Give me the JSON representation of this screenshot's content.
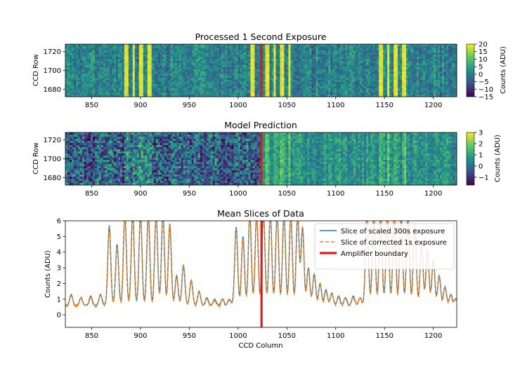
{
  "chart_data": [
    {
      "type": "heatmap",
      "title": "Processed 1 Second Exposure",
      "xlabel": "",
      "ylabel": "CCD Row",
      "xlim": [
        823,
        1224
      ],
      "ylim": [
        1672,
        1728
      ],
      "xticks": [
        850,
        900,
        950,
        1000,
        1050,
        1100,
        1150,
        1200
      ],
      "yticks": [
        1680,
        1700,
        1720
      ],
      "colorbar": {
        "label": "Counts (ADU)",
        "range": [
          -15,
          20
        ],
        "ticks": [
          -15,
          -10,
          -5,
          0,
          5,
          10,
          15,
          20
        ]
      },
      "colormap": "viridis",
      "bright_columns": [
        885,
        893,
        901,
        909,
        1015,
        1030,
        1038,
        1045,
        1053,
        1146,
        1154,
        1162,
        1170
      ],
      "amplifier_boundary": 1024
    },
    {
      "type": "heatmap",
      "title": "Model Prediction",
      "xlabel": "",
      "ylabel": "CCD Row",
      "xlim": [
        823,
        1224
      ],
      "ylim": [
        1672,
        1728
      ],
      "xticks": [
        850,
        900,
        950,
        1000,
        1050,
        1100,
        1150,
        1200
      ],
      "yticks": [
        1680,
        1700,
        1720
      ],
      "colorbar": {
        "label": "Counts (ADU)",
        "range": [
          -1.7,
          3
        ],
        "ticks": [
          -1,
          0,
          1,
          2,
          3
        ]
      },
      "colormap": "viridis",
      "amplifier_boundary": 1024
    },
    {
      "type": "line",
      "title": "Mean Slices of Data",
      "xlabel": "CCD Column",
      "ylabel": "Counts (ADU)",
      "xlim": [
        823,
        1224
      ],
      "ylim": [
        -0.8,
        6
      ],
      "xticks": [
        850,
        900,
        950,
        1000,
        1050,
        1100,
        1150,
        1200
      ],
      "yticks": [
        0,
        1,
        2,
        3,
        4,
        5,
        6
      ],
      "legend_position": "top-right",
      "legend": [
        "Slice of scaled 300s exposure",
        "Slice of corrected 1s exposure",
        "Amplifier boundary"
      ],
      "amplifier_boundary": 1024,
      "baseline": 0.6,
      "series": [
        {
          "name": "Slice of scaled 300s exposure",
          "color": "#1f77b4",
          "style": "solid"
        },
        {
          "name": "Slice of corrected 1s exposure",
          "color": "#ff7f0e",
          "style": "dashed"
        }
      ],
      "peaks": [
        {
          "x": 829,
          "y": 1.3
        },
        {
          "x": 839,
          "y": 1.1
        },
        {
          "x": 849,
          "y": 1.2
        },
        {
          "x": 859,
          "y": 1.3
        },
        {
          "x": 868,
          "y": 5.7
        },
        {
          "x": 876,
          "y": 4.5
        },
        {
          "x": 884,
          "y": 6.5
        },
        {
          "x": 892,
          "y": 6.5
        },
        {
          "x": 900,
          "y": 6.5
        },
        {
          "x": 908,
          "y": 6.5
        },
        {
          "x": 916,
          "y": 6.5
        },
        {
          "x": 923,
          "y": 6.5
        },
        {
          "x": 930,
          "y": 5.8
        },
        {
          "x": 937,
          "y": 2.5
        },
        {
          "x": 944,
          "y": 3.2
        },
        {
          "x": 952,
          "y": 2.2
        },
        {
          "x": 960,
          "y": 1.5
        },
        {
          "x": 968,
          "y": 1.1
        },
        {
          "x": 976,
          "y": 1.0
        },
        {
          "x": 984,
          "y": 1.0
        },
        {
          "x": 991,
          "y": 1.0
        },
        {
          "x": 998,
          "y": 5.6
        },
        {
          "x": 1005,
          "y": 5.0
        },
        {
          "x": 1012,
          "y": 6.5
        },
        {
          "x": 1019,
          "y": 6.5
        },
        {
          "x": 1026,
          "y": 6.5
        },
        {
          "x": 1033,
          "y": 6.5
        },
        {
          "x": 1040,
          "y": 6.5
        },
        {
          "x": 1047,
          "y": 6.5
        },
        {
          "x": 1054,
          "y": 6.5
        },
        {
          "x": 1061,
          "y": 6.5
        },
        {
          "x": 1066,
          "y": 5.6
        },
        {
          "x": 1072,
          "y": 3.0
        },
        {
          "x": 1078,
          "y": 2.6
        },
        {
          "x": 1084,
          "y": 2.0
        },
        {
          "x": 1090,
          "y": 1.6
        },
        {
          "x": 1096,
          "y": 1.4
        },
        {
          "x": 1103,
          "y": 1.2
        },
        {
          "x": 1110,
          "y": 1.1
        },
        {
          "x": 1118,
          "y": 1.2
        },
        {
          "x": 1125,
          "y": 1.1
        },
        {
          "x": 1132,
          "y": 6.5
        },
        {
          "x": 1139,
          "y": 6.5
        },
        {
          "x": 1146,
          "y": 6.5
        },
        {
          "x": 1153,
          "y": 6.5
        },
        {
          "x": 1160,
          "y": 6.5
        },
        {
          "x": 1167,
          "y": 6.5
        },
        {
          "x": 1174,
          "y": 6.5
        },
        {
          "x": 1181,
          "y": 5.8
        },
        {
          "x": 1188,
          "y": 4.6
        },
        {
          "x": 1194,
          "y": 4.2
        },
        {
          "x": 1200,
          "y": 3.5
        },
        {
          "x": 1206,
          "y": 2.5
        },
        {
          "x": 1212,
          "y": 1.8
        },
        {
          "x": 1218,
          "y": 1.3
        },
        {
          "x": 1223,
          "y": 1.0
        }
      ]
    }
  ]
}
